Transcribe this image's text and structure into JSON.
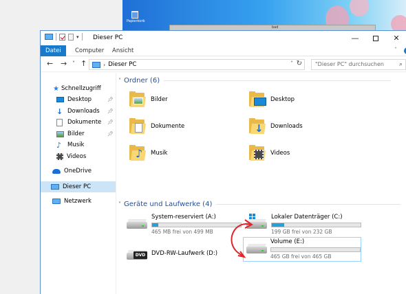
{
  "desktop": {
    "recycle_bin_label": "Papierkorb",
    "bg_window_title": "bad"
  },
  "window": {
    "title": "Dieser PC",
    "controls": {
      "minimize": "—",
      "maximize": "",
      "close": "✕"
    }
  },
  "ribbon": {
    "tabs": [
      {
        "label": "Datei",
        "active": true
      },
      {
        "label": "Computer"
      },
      {
        "label": "Ansicht"
      }
    ],
    "expand_icon": "chevron-down-icon"
  },
  "address": {
    "back": "←",
    "forward": "→",
    "recent": "˅",
    "up": "↑",
    "path": "Dieser PC",
    "search_placeholder": "\"Dieser PC\" durchsuchen"
  },
  "sidebar": {
    "items": [
      {
        "label": "Schnellzugriff",
        "icon": "star-icon",
        "pinned": false
      },
      {
        "label": "Desktop",
        "icon": "desktop-icon",
        "pinned": true
      },
      {
        "label": "Downloads",
        "icon": "download-icon",
        "pinned": true
      },
      {
        "label": "Dokumente",
        "icon": "documents-icon",
        "pinned": true
      },
      {
        "label": "Bilder",
        "icon": "pictures-icon",
        "pinned": true
      },
      {
        "label": "Musik",
        "icon": "music-icon",
        "pinned": false
      },
      {
        "label": "Videos",
        "icon": "videos-icon",
        "pinned": false
      },
      {
        "label": "OneDrive",
        "icon": "onedrive-icon",
        "pinned": false
      },
      {
        "label": "Dieser PC",
        "icon": "pc-icon",
        "selected": true
      },
      {
        "label": "Netzwerk",
        "icon": "network-icon",
        "pinned": false
      }
    ]
  },
  "folders": {
    "heading": "Ordner (6)",
    "items": [
      {
        "label": "Bilder",
        "icon": "pictures-folder-icon"
      },
      {
        "label": "Desktop",
        "icon": "desktop-folder-icon"
      },
      {
        "label": "Dokumente",
        "icon": "documents-folder-icon"
      },
      {
        "label": "Downloads",
        "icon": "downloads-folder-icon"
      },
      {
        "label": "Musik",
        "icon": "music-folder-icon"
      },
      {
        "label": "Videos",
        "icon": "videos-folder-icon"
      }
    ]
  },
  "drives": {
    "heading": "Geräte und Laufwerke (4)",
    "items": [
      {
        "label": "System-reserviert (A:)",
        "free": "465 MB frei von 499 MB",
        "used_fraction": 0.07
      },
      {
        "label": "Lokaler Datenträger (C:)",
        "free": "199 GB frei von 232 GB",
        "used_fraction": 0.14
      },
      {
        "label": "DVD-RW-Laufwerk (D:)",
        "icon_text": "DVD"
      },
      {
        "label": "Volume (E:)",
        "free": "465 GB frei von 465 GB",
        "used_fraction": 0.0,
        "selected": true
      }
    ]
  },
  "colors": {
    "accent": "#1979ca",
    "bar_fill": "#26a0da",
    "selection": "#cce4f7",
    "annotation": "#e0242a"
  }
}
